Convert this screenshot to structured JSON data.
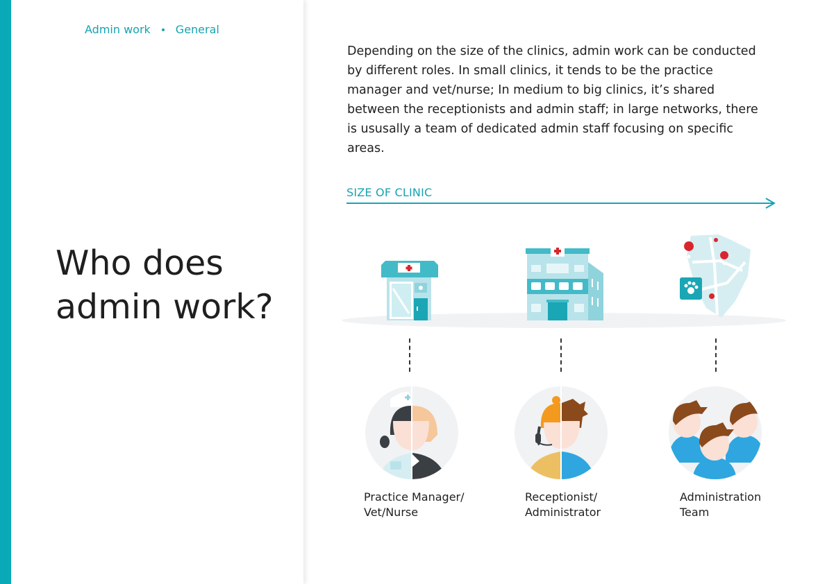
{
  "breadcrumb": {
    "section": "Admin work",
    "category": "General"
  },
  "title": {
    "line1": "Who does",
    "line2": "admin work?"
  },
  "intro": "Depending on the size of the clinics, admin work can be conducted by different roles. In small clinics, it tends to be the practice manager and vet/nurse; In medium to big clinics, it’s shared between the receptionists and admin staff; in large networks, there is ususally a team of dedicated admin staff focusing on specific areas.",
  "axis": {
    "label": "SIZE OF CLINIC"
  },
  "clinics": [
    {
      "icon": "small-clinic-icon"
    },
    {
      "icon": "medium-clinic-icon"
    },
    {
      "icon": "clinic-network-map-icon"
    }
  ],
  "roles": [
    {
      "icon": "practice-manager-vet-icon",
      "line1": "Practice Manager/",
      "line2": "Vet/Nurse"
    },
    {
      "icon": "receptionist-admin-icon",
      "line1": "Receptionist/",
      "line2": "Administrator"
    },
    {
      "icon": "admin-team-icon",
      "line1": "Administration",
      "line2": "Team"
    }
  ],
  "colors": {
    "accent": "#0aa9b7",
    "teal_light": "#8fd3dc",
    "red": "#d9262e",
    "skin": "#fbe0d6",
    "hair_brown": "#8a4a1c",
    "blue": "#2fa6e0",
    "yellow": "#ecc062",
    "orange": "#f39a1e"
  }
}
